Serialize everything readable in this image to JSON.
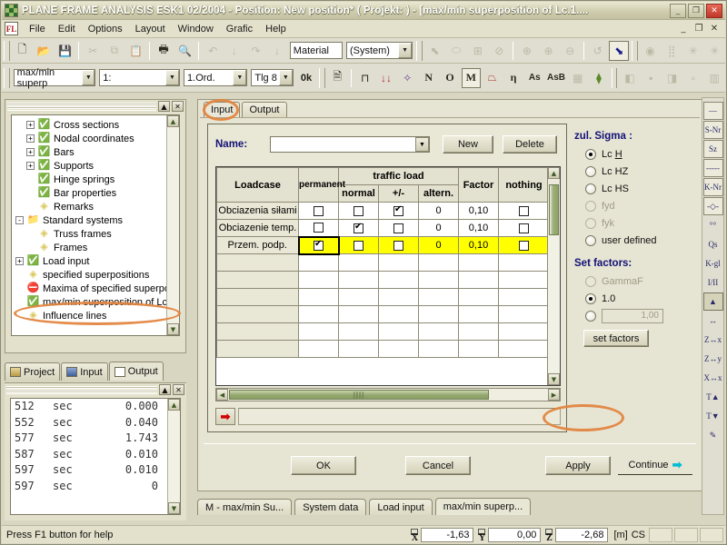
{
  "window": {
    "title": "PLANE FRAME ANALYSIS ESK1 02/2004 - Position: New position* ( Projekt:  )  - [max/min superposition of Lc.1....",
    "minimize": "_",
    "maximize": "❐",
    "close": "✕",
    "mdi_minimize": "_",
    "mdi_restore": "❐",
    "mdi_close": "✕"
  },
  "menu": {
    "app_icon_text": "FL",
    "items": [
      "File",
      "Edit",
      "Options",
      "Layout",
      "Window",
      "Grafic",
      "Help"
    ]
  },
  "toolbar1": {
    "buttons": [
      {
        "name": "new-file-icon",
        "glyph": "🗋"
      },
      {
        "name": "open-folder-icon",
        "glyph": "📂"
      },
      {
        "name": "save-icon",
        "glyph": "💾"
      },
      {
        "name": "cut-icon",
        "glyph": "✂"
      },
      {
        "name": "copy-icon",
        "glyph": "⧉"
      },
      {
        "name": "paste-icon",
        "glyph": "📋"
      },
      {
        "name": "print-icon",
        "glyph": "🖶"
      },
      {
        "name": "print-preview-icon",
        "glyph": "🔍"
      },
      {
        "name": "undo-icon",
        "glyph": "↶"
      },
      {
        "name": "undo-down-icon",
        "glyph": "↓"
      },
      {
        "name": "redo-icon",
        "glyph": "↷"
      },
      {
        "name": "redo-down-icon",
        "glyph": "↓"
      }
    ],
    "material_label": "Material",
    "material_value": "(System)",
    "right_buttons": [
      {
        "name": "pointer-tool-icon",
        "glyph": "⬉"
      },
      {
        "name": "select-region-icon",
        "glyph": "⬭"
      },
      {
        "name": "fit-window-icon",
        "glyph": "⊞"
      },
      {
        "name": "zoom-window-icon",
        "glyph": "⊘"
      },
      {
        "name": "zoom-all-icon",
        "glyph": "⊕"
      },
      {
        "name": "zoom-in-icon",
        "glyph": "⊕"
      },
      {
        "name": "zoom-out-icon",
        "glyph": "⊖"
      },
      {
        "name": "refresh-icon",
        "glyph": "↺"
      },
      {
        "name": "arrow-select-icon",
        "glyph": "⬊"
      },
      {
        "name": "render-icon",
        "glyph": "◉"
      },
      {
        "name": "grid-dots-icon",
        "glyph": "⣿"
      },
      {
        "name": "snowflake-icon",
        "glyph": "✳"
      },
      {
        "name": "snowflake2-icon",
        "glyph": "✳"
      }
    ]
  },
  "toolbar2": {
    "superposition_combo": "max/min superp",
    "scale_combo": "1:",
    "order_combo": "1.Ord.",
    "tlg_combo": "Tlg 8",
    "ok_flag": "0k",
    "result_buttons": [
      {
        "name": "report-icon",
        "glyph": "🗎"
      },
      {
        "name": "system-shape-icon",
        "glyph": "⊓"
      },
      {
        "name": "loads-icon",
        "glyph": "↓↓"
      },
      {
        "name": "deformation-icon",
        "glyph": "✧"
      },
      {
        "name": "normal-force-icon",
        "glyph": "N"
      },
      {
        "name": "shear-force-icon",
        "glyph": "O"
      },
      {
        "name": "moment-icon",
        "glyph": "M"
      },
      {
        "name": "envelope-icon",
        "glyph": "⏢"
      },
      {
        "name": "eta-sigma-icon",
        "glyph": "η"
      },
      {
        "name": "as-icon",
        "glyph": "As"
      },
      {
        "name": "asb-icon",
        "glyph": "AsB"
      },
      {
        "name": "grid-pattern-icon",
        "glyph": "▦"
      },
      {
        "name": "energy-icon",
        "glyph": "⧫"
      }
    ],
    "view_buttons": [
      {
        "name": "view-1-icon",
        "glyph": "◧"
      },
      {
        "name": "view-2-icon",
        "glyph": "▪"
      },
      {
        "name": "view-3-icon",
        "glyph": "◨"
      },
      {
        "name": "view-4-icon",
        "glyph": "▫"
      },
      {
        "name": "view-5-icon",
        "glyph": "▥"
      }
    ]
  },
  "tree": {
    "restore_btn": "▲",
    "close_btn": "✕",
    "scroll_up": "▲",
    "scroll_down": "▼",
    "items": [
      {
        "label": "Cross sections",
        "indent": 1,
        "expander": "+",
        "icon": "check-green-icon",
        "glyph": "✅"
      },
      {
        "label": "Nodal coordinates",
        "indent": 1,
        "expander": "+",
        "icon": "check-green-icon",
        "glyph": "✅"
      },
      {
        "label": "Bars",
        "indent": 1,
        "expander": "+",
        "icon": "check-green-icon",
        "glyph": "✅"
      },
      {
        "label": "Supports",
        "indent": 1,
        "expander": "+",
        "icon": "check-green-icon",
        "glyph": "✅"
      },
      {
        "label": "Hinge springs",
        "indent": 1,
        "expander": "",
        "icon": "check-green-icon",
        "glyph": "✅"
      },
      {
        "label": "Bar properties",
        "indent": 1,
        "expander": "",
        "icon": "check-green-icon",
        "glyph": "✅"
      },
      {
        "label": "Remarks",
        "indent": 1,
        "expander": "",
        "icon": "diamond-yellow-icon",
        "glyph": "◈"
      },
      {
        "label": "Standard systems",
        "indent": 0,
        "expander": "-",
        "icon": "folder-icon",
        "glyph": "📁"
      },
      {
        "label": "Truss frames",
        "indent": 1,
        "expander": "",
        "icon": "diamond-yellow-icon",
        "glyph": "◈"
      },
      {
        "label": "Frames",
        "indent": 1,
        "expander": "",
        "icon": "diamond-yellow-icon",
        "glyph": "◈"
      },
      {
        "label": "Load input",
        "indent": 0,
        "expander": "+",
        "icon": "check-green-icon",
        "glyph": "✅"
      },
      {
        "label": "specified superpositions",
        "indent": 0,
        "expander": "",
        "icon": "diamond-yellow-icon",
        "glyph": "◈"
      },
      {
        "label": "Maxima of specified superpo",
        "indent": 0,
        "expander": "",
        "icon": "stop-red-icon",
        "glyph": "⛔"
      },
      {
        "label": "max/min superposition of Lc",
        "indent": 0,
        "expander": "",
        "icon": "check-green-icon",
        "glyph": "✅"
      },
      {
        "label": "Influence lines",
        "indent": 0,
        "expander": "",
        "icon": "diamond-yellow-icon",
        "glyph": "◈"
      }
    ]
  },
  "lower_tabs": [
    {
      "label": "Project",
      "icon": "project-folder-icon",
      "active": false
    },
    {
      "label": "Input",
      "icon": "input-form-icon",
      "active": false
    },
    {
      "label": "Output",
      "icon": "output-doc-icon",
      "active": true
    }
  ],
  "output_panel": {
    "restore_btn": "▲",
    "close_btn": "✕",
    "scroll_up": "▲",
    "scroll_down": "▼",
    "rows": [
      {
        "id": "512",
        "unit": "sec",
        "value": "0.000"
      },
      {
        "id": "552",
        "unit": "sec",
        "value": "0.040"
      },
      {
        "id": "577",
        "unit": "sec",
        "value": "1.743"
      },
      {
        "id": "587",
        "unit": "sec",
        "value": "0.010"
      },
      {
        "id": "597",
        "unit": "sec",
        "value": "0.010"
      },
      {
        "id": "597",
        "unit": "sec",
        "value": "0"
      }
    ]
  },
  "dialog": {
    "tabs": [
      {
        "label": "Input",
        "active": true
      },
      {
        "label": "Output",
        "active": false
      }
    ],
    "name_label": "Name:",
    "name_value": "",
    "name_placeholder": "",
    "new_button": "New",
    "delete_button": "Delete",
    "table": {
      "headers": {
        "loadcase": "Loadcase",
        "permanent": "permanent",
        "traffic_load": "traffic load",
        "normal": "normal",
        "plus_minus": "+/-",
        "altern": "altern.",
        "factor": "Factor",
        "nothing": "nothing"
      },
      "rows": [
        {
          "loadcase": "Obciazenia siłami",
          "permanent": false,
          "normal": false,
          "plusminus": true,
          "altern": "0",
          "factor": "0,10",
          "nothing": false,
          "highlight": false
        },
        {
          "loadcase": "Obciazenie temp.",
          "permanent": false,
          "normal": true,
          "plusminus": false,
          "altern": "0",
          "factor": "0,10",
          "nothing": false,
          "highlight": false
        },
        {
          "loadcase": "Przem. podp.",
          "permanent": true,
          "normal": false,
          "plusminus": false,
          "altern": "0",
          "factor": "0,10",
          "nothing": false,
          "highlight": true
        }
      ],
      "empty_rows": 6,
      "hscroll_left": "◀",
      "hscroll_right": "▶",
      "vscroll_up": "▲",
      "vscroll_down": "▼"
    },
    "command_arrow": "➡",
    "command_value": "",
    "sigma": {
      "title": "zul. Sigma :",
      "options": [
        {
          "label": "Lc H",
          "selected": true,
          "disabled": false,
          "underline": "H"
        },
        {
          "label": "Lc HZ",
          "selected": false,
          "disabled": false,
          "underline": ""
        },
        {
          "label": "Lc HS",
          "selected": false,
          "disabled": false,
          "underline": ""
        },
        {
          "label": "fyd",
          "selected": false,
          "disabled": true,
          "underline": ""
        },
        {
          "label": "fyk",
          "selected": false,
          "disabled": true,
          "underline": ""
        },
        {
          "label": "user defined",
          "selected": false,
          "disabled": false,
          "underline": ""
        }
      ]
    },
    "set_factors": {
      "title": "Set factors:",
      "options": [
        {
          "label": "GammaF",
          "selected": false,
          "disabled": true
        },
        {
          "label": "1.0",
          "selected": true,
          "disabled": false
        }
      ],
      "custom_value": "1,00",
      "custom_selected": false,
      "button": "set factors"
    },
    "buttons": {
      "ok": "OK",
      "cancel": "Cancel",
      "apply": "Apply",
      "continue": "Continue",
      "continue_arrow": "➡"
    }
  },
  "vtoolbar": {
    "buttons": [
      {
        "name": "line-tool-icon",
        "label": "—"
      },
      {
        "name": "s-nr-icon",
        "label": "S-Nr"
      },
      {
        "name": "sz-icon",
        "label": "Sz"
      },
      {
        "name": "dashed-line-icon",
        "label": "-----"
      },
      {
        "name": "k-nr-icon",
        "label": "K-Nr"
      },
      {
        "name": "node-symbol-icon",
        "label": "-◇-"
      },
      {
        "name": "points-icon",
        "label": "°°"
      },
      {
        "name": "qs-icon",
        "label": "Qs"
      },
      {
        "name": "k-gl-icon",
        "label": "K-gl"
      },
      {
        "name": "order-icon",
        "label": "I/II"
      },
      {
        "name": "support-fill-icon",
        "label": "▲"
      },
      {
        "name": "dimension-icon",
        "label": "↔"
      },
      {
        "name": "zx-axis-icon",
        "label": "Z↔x"
      },
      {
        "name": "zy-axis-icon",
        "label": "Z↔y"
      },
      {
        "name": "xx-axis-icon",
        "label": "X↔x"
      },
      {
        "name": "temp-up-icon",
        "label": "T▲"
      },
      {
        "name": "temp-down-icon",
        "label": "T▼"
      },
      {
        "name": "pencil-icon",
        "label": "✎"
      }
    ]
  },
  "window_tabs": [
    {
      "label": "M - max/min Su...",
      "active": false
    },
    {
      "label": "System data",
      "active": false
    },
    {
      "label": "Load input",
      "active": false
    },
    {
      "label": "max/min superp...",
      "active": true
    }
  ],
  "statusbar": {
    "message": "Press F1 button for help",
    "coords": [
      {
        "axis": "X",
        "value": "-1,63"
      },
      {
        "axis": "Y",
        "value": "0,00"
      },
      {
        "axis": "Z",
        "value": "-2,68"
      }
    ],
    "unit": "[m]",
    "cs": "CS"
  },
  "colors": {
    "accent_highlight": "#e2823c",
    "row_highlight": "#ffff00",
    "label_blue": "#121278",
    "title_green": "#9aa878",
    "close_red": "#c0362a",
    "continue_cyan": "#00bcd4"
  }
}
